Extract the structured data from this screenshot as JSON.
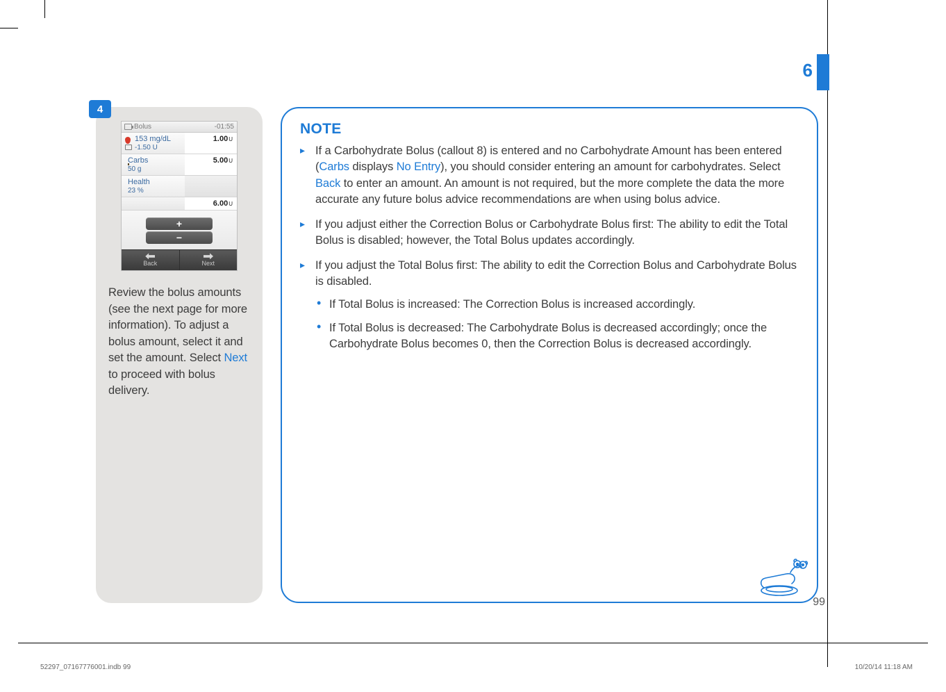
{
  "chapter": "6",
  "page_number": "99",
  "step": {
    "number": "4",
    "caption_pre": "Review the bolus amounts (see the next page for more information). To adjust a bolus amount, select it and set the amount. Select ",
    "caption_link": "Next",
    "caption_post": " to proceed with bolus delivery."
  },
  "device": {
    "title": "Bolus",
    "timer": "-01:55",
    "rows": [
      {
        "label_top": "153 mg/dL",
        "label_bottom": "-1.50 U",
        "value": "1.00",
        "unit": "U",
        "icon": "drop"
      },
      {
        "label_top": "Carbs",
        "label_bottom": "50 g",
        "value": "5.00",
        "unit": "U",
        "icon": "apple"
      },
      {
        "label_top": "Health",
        "label_bottom": "23 %",
        "value": "",
        "unit": "",
        "icon": "heart",
        "blank": true
      }
    ],
    "total": {
      "value": "6.00",
      "unit": "U"
    },
    "plus": "+",
    "minus": "−",
    "back": "Back",
    "next": "Next"
  },
  "note": {
    "title": "NOTE",
    "items": [
      {
        "segments": [
          {
            "t": "If a Carbohydrate Bolus (callout 8) is entered and no Carbohydrate Amount has been entered ("
          },
          {
            "t": "Carbs",
            "link": true
          },
          {
            "t": " displays "
          },
          {
            "t": "No Entry",
            "link": true
          },
          {
            "t": "), you should consider entering an amount for carbohydrates. Select "
          },
          {
            "t": "Back",
            "link": true
          },
          {
            "t": " to enter an amount. An amount is not required, but the more complete the data the more accurate any future bolus advice recommendations are when using bolus advice."
          }
        ]
      },
      {
        "segments": [
          {
            "t": "If you adjust either the Correction Bolus or Carbohydrate Bolus first: The ability to edit the Total Bolus is disabled; however, the Total Bolus updates accordingly."
          }
        ]
      },
      {
        "segments": [
          {
            "t": "If you adjust the Total Bolus first: The ability to edit the Correction Bolus and Carbohydrate Bolus is disabled."
          }
        ],
        "subs": [
          "If Total Bolus is increased: The Correction Bolus is increased accordingly.",
          "If Total Bolus is decreased: The Carbohydrate Bolus is decreased accordingly; once the Carbohydrate Bolus becomes 0, then the Correction Bolus is decreased accordingly."
        ]
      }
    ]
  },
  "imprint": {
    "left": "52297_07167776001.indb   99",
    "right": "10/20/14   11:18 AM"
  }
}
